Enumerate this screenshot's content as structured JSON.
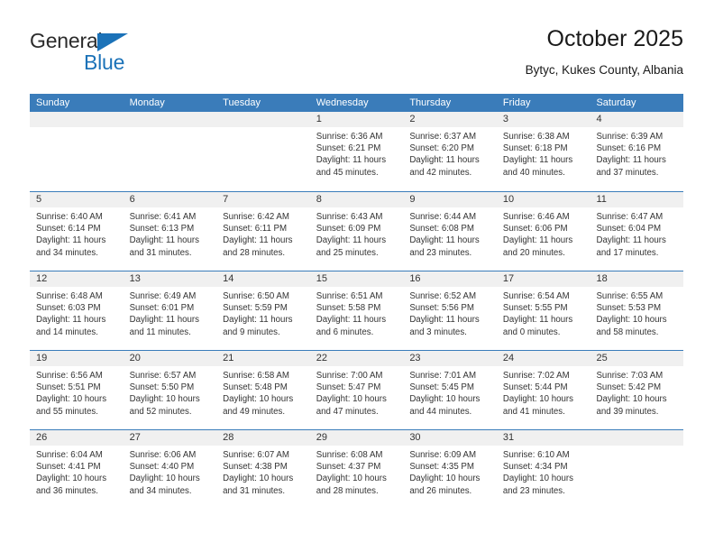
{
  "brand": {
    "name_top": "General",
    "name_bottom": "Blue",
    "accent_color": "#1b72b8"
  },
  "header": {
    "title": "October 2025",
    "location": "Bytyc, Kukes County, Albania"
  },
  "calendar": {
    "header_color": "#3a7cba",
    "daynumber_bg": "#f0f0f0",
    "weekday_headers": [
      "Sunday",
      "Monday",
      "Tuesday",
      "Wednesday",
      "Thursday",
      "Friday",
      "Saturday"
    ],
    "weeks": [
      [
        {
          "day": "",
          "sunrise": "",
          "sunset": "",
          "daylight_a": "",
          "daylight_b": ""
        },
        {
          "day": "",
          "sunrise": "",
          "sunset": "",
          "daylight_a": "",
          "daylight_b": ""
        },
        {
          "day": "",
          "sunrise": "",
          "sunset": "",
          "daylight_a": "",
          "daylight_b": ""
        },
        {
          "day": "1",
          "sunrise": "Sunrise: 6:36 AM",
          "sunset": "Sunset: 6:21 PM",
          "daylight_a": "Daylight: 11 hours",
          "daylight_b": "and 45 minutes."
        },
        {
          "day": "2",
          "sunrise": "Sunrise: 6:37 AM",
          "sunset": "Sunset: 6:20 PM",
          "daylight_a": "Daylight: 11 hours",
          "daylight_b": "and 42 minutes."
        },
        {
          "day": "3",
          "sunrise": "Sunrise: 6:38 AM",
          "sunset": "Sunset: 6:18 PM",
          "daylight_a": "Daylight: 11 hours",
          "daylight_b": "and 40 minutes."
        },
        {
          "day": "4",
          "sunrise": "Sunrise: 6:39 AM",
          "sunset": "Sunset: 6:16 PM",
          "daylight_a": "Daylight: 11 hours",
          "daylight_b": "and 37 minutes."
        }
      ],
      [
        {
          "day": "5",
          "sunrise": "Sunrise: 6:40 AM",
          "sunset": "Sunset: 6:14 PM",
          "daylight_a": "Daylight: 11 hours",
          "daylight_b": "and 34 minutes."
        },
        {
          "day": "6",
          "sunrise": "Sunrise: 6:41 AM",
          "sunset": "Sunset: 6:13 PM",
          "daylight_a": "Daylight: 11 hours",
          "daylight_b": "and 31 minutes."
        },
        {
          "day": "7",
          "sunrise": "Sunrise: 6:42 AM",
          "sunset": "Sunset: 6:11 PM",
          "daylight_a": "Daylight: 11 hours",
          "daylight_b": "and 28 minutes."
        },
        {
          "day": "8",
          "sunrise": "Sunrise: 6:43 AM",
          "sunset": "Sunset: 6:09 PM",
          "daylight_a": "Daylight: 11 hours",
          "daylight_b": "and 25 minutes."
        },
        {
          "day": "9",
          "sunrise": "Sunrise: 6:44 AM",
          "sunset": "Sunset: 6:08 PM",
          "daylight_a": "Daylight: 11 hours",
          "daylight_b": "and 23 minutes."
        },
        {
          "day": "10",
          "sunrise": "Sunrise: 6:46 AM",
          "sunset": "Sunset: 6:06 PM",
          "daylight_a": "Daylight: 11 hours",
          "daylight_b": "and 20 minutes."
        },
        {
          "day": "11",
          "sunrise": "Sunrise: 6:47 AM",
          "sunset": "Sunset: 6:04 PM",
          "daylight_a": "Daylight: 11 hours",
          "daylight_b": "and 17 minutes."
        }
      ],
      [
        {
          "day": "12",
          "sunrise": "Sunrise: 6:48 AM",
          "sunset": "Sunset: 6:03 PM",
          "daylight_a": "Daylight: 11 hours",
          "daylight_b": "and 14 minutes."
        },
        {
          "day": "13",
          "sunrise": "Sunrise: 6:49 AM",
          "sunset": "Sunset: 6:01 PM",
          "daylight_a": "Daylight: 11 hours",
          "daylight_b": "and 11 minutes."
        },
        {
          "day": "14",
          "sunrise": "Sunrise: 6:50 AM",
          "sunset": "Sunset: 5:59 PM",
          "daylight_a": "Daylight: 11 hours",
          "daylight_b": "and 9 minutes."
        },
        {
          "day": "15",
          "sunrise": "Sunrise: 6:51 AM",
          "sunset": "Sunset: 5:58 PM",
          "daylight_a": "Daylight: 11 hours",
          "daylight_b": "and 6 minutes."
        },
        {
          "day": "16",
          "sunrise": "Sunrise: 6:52 AM",
          "sunset": "Sunset: 5:56 PM",
          "daylight_a": "Daylight: 11 hours",
          "daylight_b": "and 3 minutes."
        },
        {
          "day": "17",
          "sunrise": "Sunrise: 6:54 AM",
          "sunset": "Sunset: 5:55 PM",
          "daylight_a": "Daylight: 11 hours",
          "daylight_b": "and 0 minutes."
        },
        {
          "day": "18",
          "sunrise": "Sunrise: 6:55 AM",
          "sunset": "Sunset: 5:53 PM",
          "daylight_a": "Daylight: 10 hours",
          "daylight_b": "and 58 minutes."
        }
      ],
      [
        {
          "day": "19",
          "sunrise": "Sunrise: 6:56 AM",
          "sunset": "Sunset: 5:51 PM",
          "daylight_a": "Daylight: 10 hours",
          "daylight_b": "and 55 minutes."
        },
        {
          "day": "20",
          "sunrise": "Sunrise: 6:57 AM",
          "sunset": "Sunset: 5:50 PM",
          "daylight_a": "Daylight: 10 hours",
          "daylight_b": "and 52 minutes."
        },
        {
          "day": "21",
          "sunrise": "Sunrise: 6:58 AM",
          "sunset": "Sunset: 5:48 PM",
          "daylight_a": "Daylight: 10 hours",
          "daylight_b": "and 49 minutes."
        },
        {
          "day": "22",
          "sunrise": "Sunrise: 7:00 AM",
          "sunset": "Sunset: 5:47 PM",
          "daylight_a": "Daylight: 10 hours",
          "daylight_b": "and 47 minutes."
        },
        {
          "day": "23",
          "sunrise": "Sunrise: 7:01 AM",
          "sunset": "Sunset: 5:45 PM",
          "daylight_a": "Daylight: 10 hours",
          "daylight_b": "and 44 minutes."
        },
        {
          "day": "24",
          "sunrise": "Sunrise: 7:02 AM",
          "sunset": "Sunset: 5:44 PM",
          "daylight_a": "Daylight: 10 hours",
          "daylight_b": "and 41 minutes."
        },
        {
          "day": "25",
          "sunrise": "Sunrise: 7:03 AM",
          "sunset": "Sunset: 5:42 PM",
          "daylight_a": "Daylight: 10 hours",
          "daylight_b": "and 39 minutes."
        }
      ],
      [
        {
          "day": "26",
          "sunrise": "Sunrise: 6:04 AM",
          "sunset": "Sunset: 4:41 PM",
          "daylight_a": "Daylight: 10 hours",
          "daylight_b": "and 36 minutes."
        },
        {
          "day": "27",
          "sunrise": "Sunrise: 6:06 AM",
          "sunset": "Sunset: 4:40 PM",
          "daylight_a": "Daylight: 10 hours",
          "daylight_b": "and 34 minutes."
        },
        {
          "day": "28",
          "sunrise": "Sunrise: 6:07 AM",
          "sunset": "Sunset: 4:38 PM",
          "daylight_a": "Daylight: 10 hours",
          "daylight_b": "and 31 minutes."
        },
        {
          "day": "29",
          "sunrise": "Sunrise: 6:08 AM",
          "sunset": "Sunset: 4:37 PM",
          "daylight_a": "Daylight: 10 hours",
          "daylight_b": "and 28 minutes."
        },
        {
          "day": "30",
          "sunrise": "Sunrise: 6:09 AM",
          "sunset": "Sunset: 4:35 PM",
          "daylight_a": "Daylight: 10 hours",
          "daylight_b": "and 26 minutes."
        },
        {
          "day": "31",
          "sunrise": "Sunrise: 6:10 AM",
          "sunset": "Sunset: 4:34 PM",
          "daylight_a": "Daylight: 10 hours",
          "daylight_b": "and 23 minutes."
        },
        {
          "day": "",
          "sunrise": "",
          "sunset": "",
          "daylight_a": "",
          "daylight_b": ""
        }
      ]
    ]
  }
}
